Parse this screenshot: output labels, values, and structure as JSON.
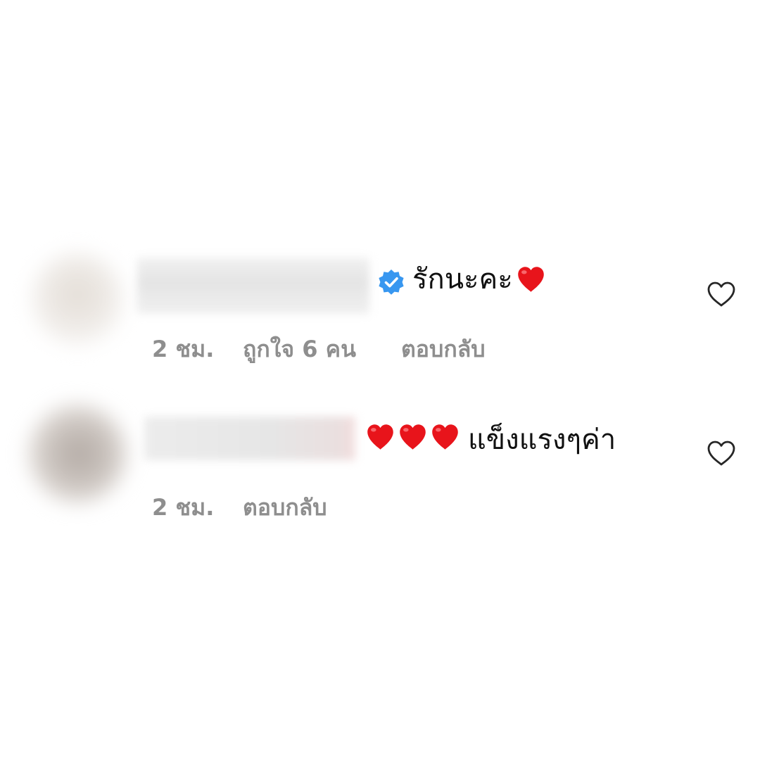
{
  "comments": [
    {
      "text": "รักนะคะ",
      "verified": true,
      "trailing_emoji": "red-heart",
      "time": "2 ชม.",
      "likes": "ถูกใจ 6 คน",
      "reply": "ตอบกลับ"
    },
    {
      "leading_emoji": [
        "red-heart",
        "red-heart",
        "red-heart"
      ],
      "text": "แข็งแรงๆค่า",
      "time": "2 ชม.",
      "reply": "ตอบกลับ"
    }
  ],
  "colors": {
    "text": "#111111",
    "meta": "#8e8e8e",
    "verified_blue": "#3897f0",
    "heart_red": "#e8141b"
  },
  "icons": {
    "like": "heart-outline-icon",
    "verified": "verified-badge-icon"
  }
}
